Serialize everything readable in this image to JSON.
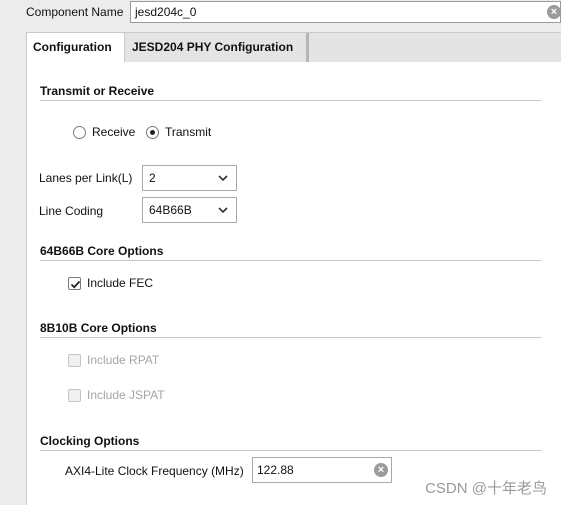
{
  "component": {
    "label": "Component Name",
    "value": "jesd204c_0"
  },
  "tabs": [
    {
      "label": "Configuration"
    },
    {
      "label": "JESD204 PHY Configuration"
    }
  ],
  "transmit_receive": {
    "title": "Transmit or Receive",
    "options": [
      {
        "label": "Receive",
        "checked": false
      },
      {
        "label": "Transmit",
        "checked": true
      }
    ]
  },
  "lanes": {
    "label": "Lanes per Link(L)",
    "value": "2"
  },
  "line_coding": {
    "label": "Line Coding",
    "value": "64B66B"
  },
  "core_64b66b": {
    "title": "64B66B Core Options",
    "include_fec": {
      "label": "Include FEC",
      "checked": true
    }
  },
  "core_8b10b": {
    "title": "8B10B Core Options",
    "include_rpat": {
      "label": "Include RPAT",
      "checked": false,
      "disabled": true
    },
    "include_jspat": {
      "label": "Include JSPAT",
      "checked": false,
      "disabled": true
    }
  },
  "clocking": {
    "title": "Clocking Options",
    "axi_label": "AXI4-Lite Clock Frequency (MHz)",
    "axi_value": "122.88"
  },
  "watermark": "CSDN @十年老鸟",
  "icons": {
    "clear": "clear-icon",
    "dropdown": "chevron-down-icon",
    "check": "check-icon"
  }
}
